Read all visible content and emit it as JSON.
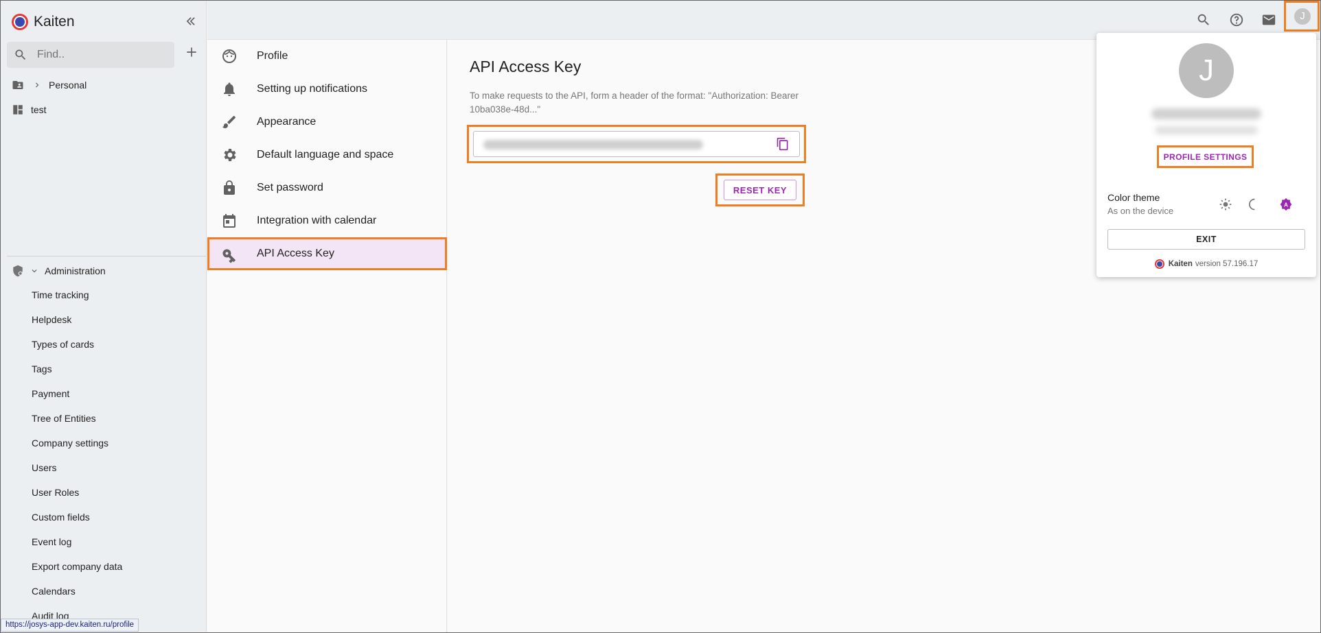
{
  "app": {
    "name": "Kaiten"
  },
  "sidebar": {
    "search_placeholder": "Find..",
    "spaces": [
      {
        "label": "Personal"
      },
      {
        "label": "test"
      }
    ],
    "admin": {
      "label": "Administration",
      "items": [
        "Time tracking",
        "Helpdesk",
        "Types of cards",
        "Tags",
        "Payment",
        "Tree of Entities",
        "Company settings",
        "Users",
        "User Roles",
        "Custom fields",
        "Event log",
        "Export company data",
        "Calendars",
        "Audit log"
      ]
    }
  },
  "settings_nav": {
    "items": [
      {
        "label": "Profile",
        "icon": "face-icon"
      },
      {
        "label": "Setting up notifications",
        "icon": "bell-icon"
      },
      {
        "label": "Appearance",
        "icon": "brush-icon"
      },
      {
        "label": "Default language and space",
        "icon": "gear-icon"
      },
      {
        "label": "Set password",
        "icon": "lock-icon"
      },
      {
        "label": "Integration with calendar",
        "icon": "calendar-icon"
      },
      {
        "label": "API Access Key",
        "icon": "key-icon",
        "active": true
      }
    ]
  },
  "main": {
    "title": "API Access Key",
    "description": "To make requests to the API, form a header of the format: \"Authorization: Bearer 10ba038e-48d...\"",
    "reset_label": "RESET KEY"
  },
  "popup": {
    "avatar_letter": "J",
    "profile_settings_label": "PROFILE SETTINGS",
    "color_theme_label": "Color theme",
    "color_theme_value": "As on the device",
    "exit_label": "EXIT",
    "version_brand": "Kaiten",
    "version_text": "version 57.196.17"
  },
  "status_url": "https://josys-app-dev.kaiten.ru/profile",
  "colors": {
    "accent": "#9c27b0",
    "highlight": "#ef7d22",
    "active_bg": "#f3e5f5"
  }
}
